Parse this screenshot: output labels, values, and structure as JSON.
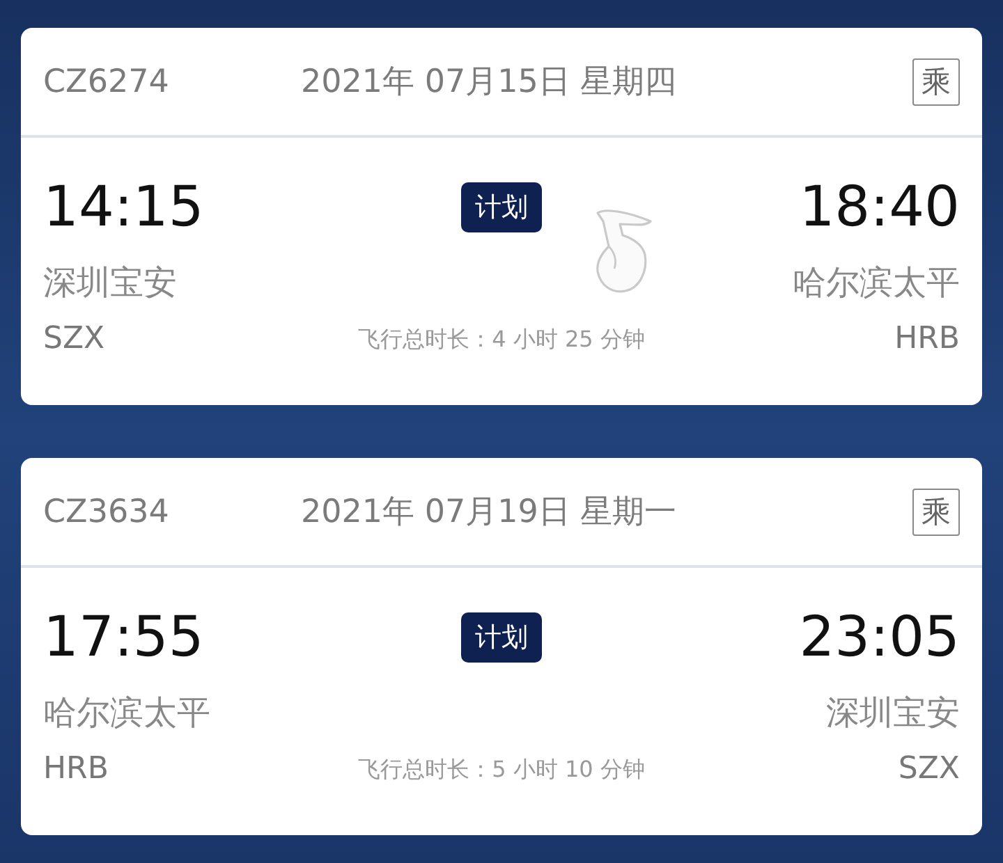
{
  "flights": [
    {
      "flight_no": "CZ6274",
      "date": "2021年 07月15日 星期四",
      "boarding_tag": "乘",
      "depart_time": "14:15",
      "status": "计划",
      "arrive_time": "18:40",
      "depart_city": "深圳宝安",
      "arrive_city": "哈尔滨太平",
      "depart_code": "SZX",
      "duration": "飞行总时长：4 小时 25 分钟",
      "arrive_code": "HRB",
      "hand_hint": true
    },
    {
      "flight_no": "CZ3634",
      "date": "2021年 07月19日 星期一",
      "boarding_tag": "乘",
      "depart_time": "17:55",
      "status": "计划",
      "arrive_time": "23:05",
      "depart_city": "哈尔滨太平",
      "arrive_city": "深圳宝安",
      "depart_code": "HRB",
      "duration": "飞行总时长：5 小时 10 分钟",
      "arrive_code": "SZX",
      "hand_hint": false
    }
  ]
}
